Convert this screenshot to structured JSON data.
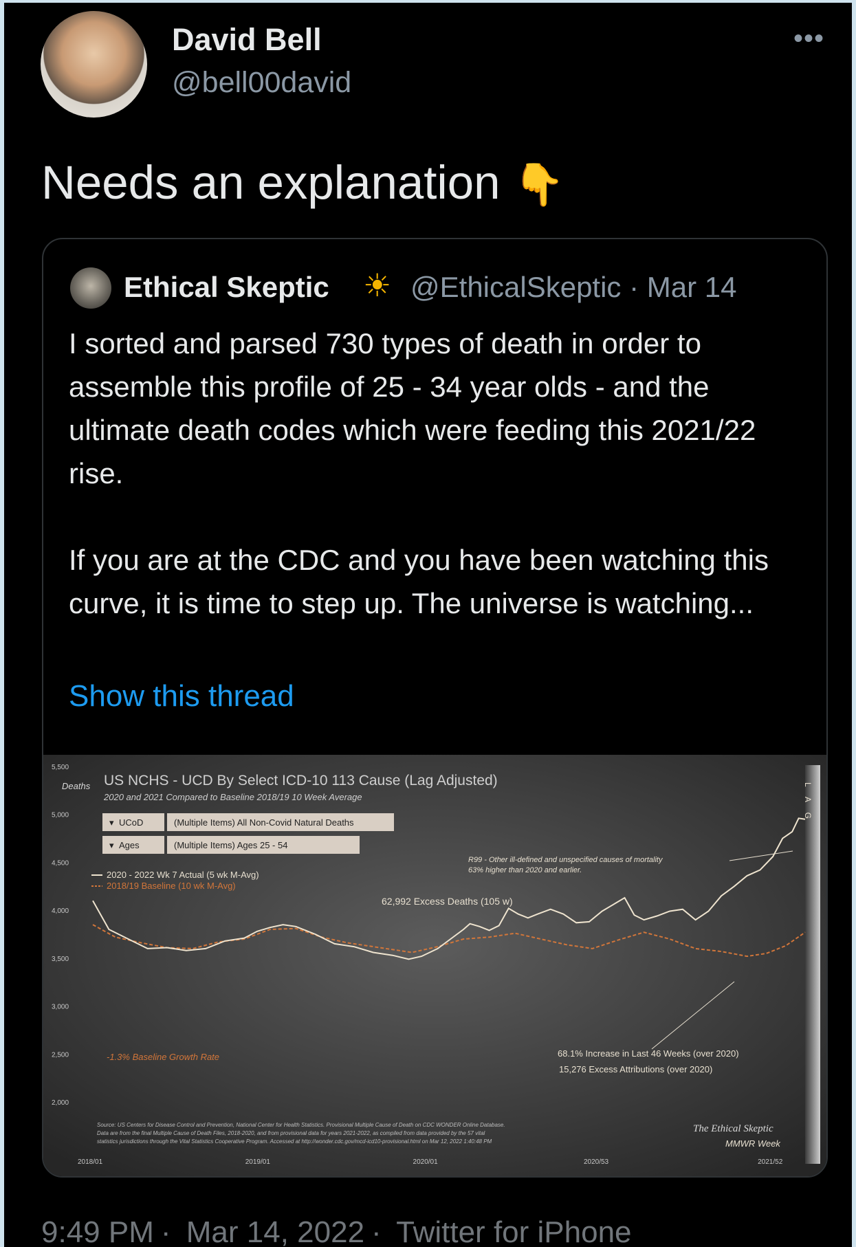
{
  "author": {
    "name": "David Bell",
    "handle": "@bell00david"
  },
  "tweet": {
    "text": "Needs an explanation",
    "emoji": "👇"
  },
  "quote": {
    "name": "Ethical Skeptic",
    "badge": "☀",
    "handle": "@EthicalSkeptic",
    "date": "Mar 14",
    "para1": "I sorted and parsed 730 types of death in order to assemble this profile of 25 - 34 year olds - and the ultimate death codes which were feeding this 2021/22 rise.",
    "para2": "If you are at the CDC and you have been watching this curve, it is time to step up. The universe is watching...",
    "link": "Show this thread"
  },
  "footer": {
    "time": "9:49 PM",
    "date": "Mar 14, 2022",
    "source": "Twitter for iPhone"
  },
  "chart_data": {
    "type": "line",
    "title": "US NCHS - UCD By Select ICD-10 113 Cause (Lag Adjusted)",
    "subtitle": "2020 and 2021 Compared to Baseline 2018/19 10 Week Average",
    "ylabel": "Deaths",
    "xlabel": "MMWR Week",
    "ylim": [
      2000,
      5500
    ],
    "yticks": [
      "5,500",
      "5,000",
      "4,500",
      "4,000",
      "3,500",
      "3,000",
      "2,500",
      "2,000"
    ],
    "xticks": [
      "2018/01",
      "2019/01",
      "2020/01",
      "2020/53",
      "2021/52"
    ],
    "filters": [
      {
        "label": "UCoD",
        "value": "(Multiple Items) All Non-Covid Natural Deaths"
      },
      {
        "label": "Ages",
        "value": "(Multiple Items) Ages 25 - 54"
      }
    ],
    "series": [
      {
        "name": "2020 - 2022 Wk 7 Actual (5 wk M-Avg)",
        "color": "#efe4cf",
        "points": [
          [
            1,
            4100
          ],
          [
            6,
            3800
          ],
          [
            12,
            3700
          ],
          [
            18,
            3600
          ],
          [
            24,
            3610
          ],
          [
            30,
            3580
          ],
          [
            36,
            3600
          ],
          [
            42,
            3680
          ],
          [
            48,
            3710
          ],
          [
            52,
            3780
          ],
          [
            56,
            3820
          ],
          [
            60,
            3850
          ],
          [
            64,
            3830
          ],
          [
            70,
            3750
          ],
          [
            76,
            3650
          ],
          [
            82,
            3620
          ],
          [
            88,
            3560
          ],
          [
            94,
            3530
          ],
          [
            99,
            3490
          ],
          [
            103,
            3520
          ],
          [
            108,
            3600
          ],
          [
            112,
            3700
          ],
          [
            116,
            3800
          ],
          [
            118,
            3860
          ],
          [
            121,
            3830
          ],
          [
            124,
            3790
          ],
          [
            127,
            3840
          ],
          [
            130,
            4020
          ],
          [
            133,
            3960
          ],
          [
            136,
            3920
          ],
          [
            139,
            3960
          ],
          [
            143,
            4010
          ],
          [
            147,
            3960
          ],
          [
            151,
            3870
          ],
          [
            155,
            3880
          ],
          [
            159,
            3990
          ],
          [
            163,
            4070
          ],
          [
            166,
            4130
          ],
          [
            169,
            3950
          ],
          [
            172,
            3900
          ],
          [
            176,
            3940
          ],
          [
            180,
            3990
          ],
          [
            184,
            4010
          ],
          [
            188,
            3900
          ],
          [
            192,
            3990
          ],
          [
            196,
            4150
          ],
          [
            200,
            4250
          ],
          [
            204,
            4360
          ],
          [
            208,
            4420
          ],
          [
            212,
            4560
          ],
          [
            215,
            4750
          ],
          [
            218,
            4820
          ],
          [
            220,
            4960
          ],
          [
            222,
            4950
          ]
        ]
      },
      {
        "name": "2018/19 Baseline (10 wk M-Avg)",
        "color": "#d2763a",
        "points": [
          [
            1,
            3850
          ],
          [
            8,
            3720
          ],
          [
            16,
            3660
          ],
          [
            24,
            3610
          ],
          [
            32,
            3600
          ],
          [
            40,
            3670
          ],
          [
            48,
            3700
          ],
          [
            56,
            3800
          ],
          [
            64,
            3810
          ],
          [
            72,
            3720
          ],
          [
            80,
            3660
          ],
          [
            90,
            3610
          ],
          [
            100,
            3560
          ],
          [
            108,
            3620
          ],
          [
            116,
            3700
          ],
          [
            124,
            3720
          ],
          [
            132,
            3760
          ],
          [
            140,
            3700
          ],
          [
            148,
            3640
          ],
          [
            156,
            3600
          ],
          [
            164,
            3690
          ],
          [
            172,
            3770
          ],
          [
            180,
            3700
          ],
          [
            188,
            3600
          ],
          [
            196,
            3570
          ],
          [
            204,
            3520
          ],
          [
            210,
            3550
          ],
          [
            216,
            3630
          ],
          [
            222,
            3770
          ]
        ]
      }
    ],
    "annotations": [
      "62,992 Excess Deaths (105 w)",
      "R99 - Other ill-defined and unspecified causes of mortality",
      "63% higher than 2020 and earlier.",
      "68.1% Increase in Last 46 Weeks (over 2020)",
      "15,276 Excess Attributions (over 2020)",
      "-1.3% Baseline Growth Rate",
      "L A G"
    ],
    "source_lines": [
      "Source: US Centers for Disease Control and Prevention, National Center for Health Statistics. Provisional Multiple Cause of Death on CDC WONDER Online Database.",
      "Data are from the final Multiple Cause of Death Files, 2018-2020, and from provisional data for years 2021-2022, as compiled from data provided by the 57 vital",
      "statistics jurisdictions through the Vital Statistics Cooperative Program. Accessed at http://wonder.cdc.gov/mcd-icd10-provisional.html on Mar 12, 2022 1:40:48 PM"
    ],
    "signature": "The Ethical Skeptic"
  }
}
